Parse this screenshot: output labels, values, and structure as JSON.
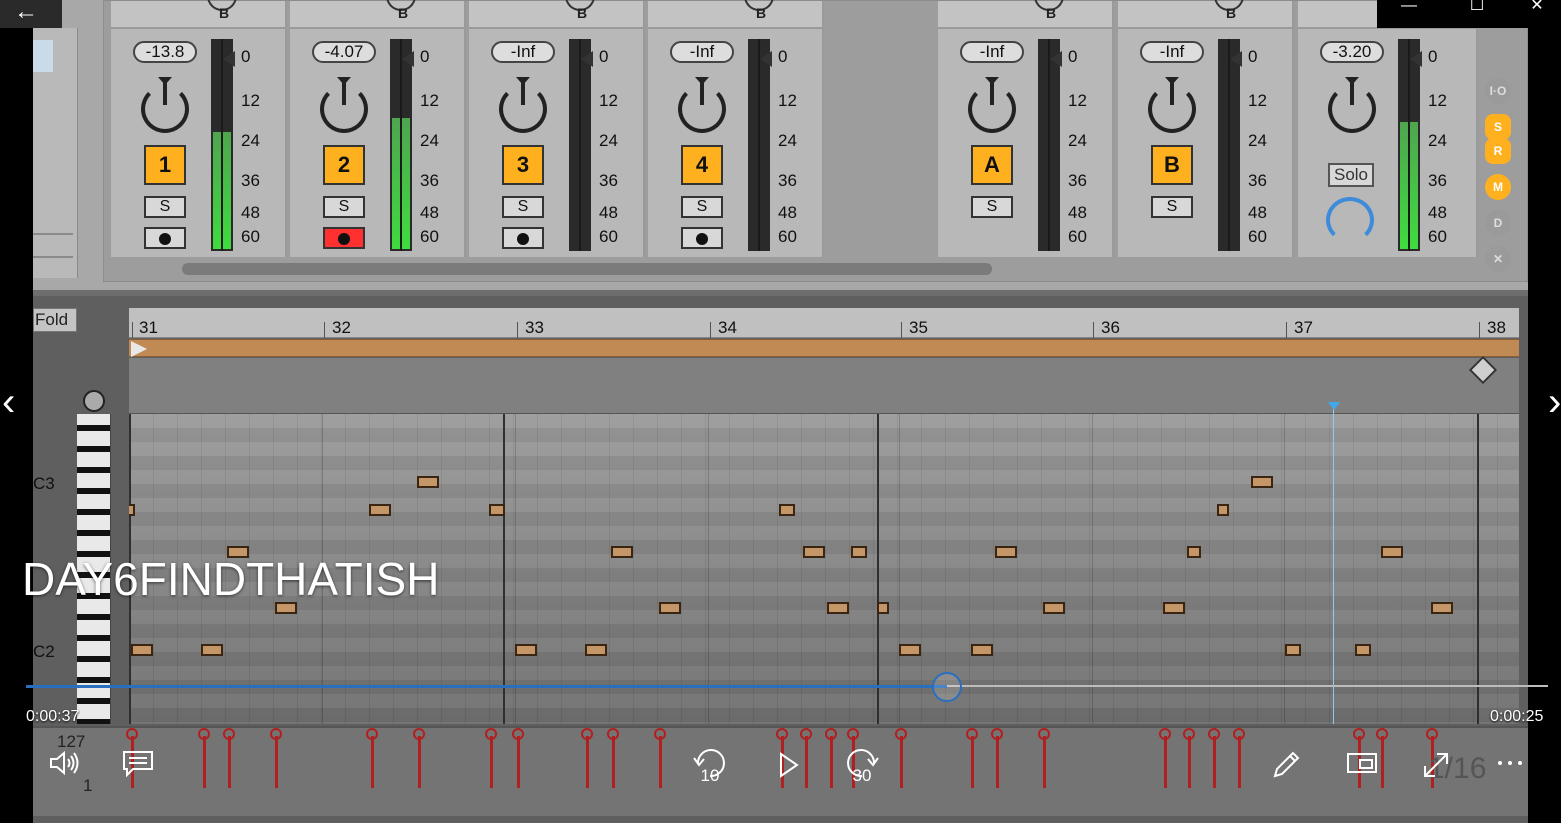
{
  "player": {
    "title": "DAY6FINDTHATISH",
    "elapsed": "0:00:37",
    "remaining": "0:00:25",
    "progress_fraction": 0.605,
    "accent_color": "#2a6fbf",
    "back_icon": "arrow-left-icon",
    "skip_back_label": "10",
    "skip_forward_label": "30",
    "window_controls": [
      "minimize-icon",
      "maximize-icon",
      "close-icon"
    ]
  },
  "mixer": {
    "strips": [
      {
        "id": "1",
        "volume": "-13.8",
        "ab": "B",
        "meter_level": 0.55,
        "solo": "S",
        "armed": false,
        "type": "audio"
      },
      {
        "id": "2",
        "volume": "-4.07",
        "ab": "B",
        "meter_level": 0.62,
        "solo": "S",
        "armed": true,
        "type": "audio"
      },
      {
        "id": "3",
        "volume": "-Inf",
        "ab": "B",
        "meter_level": 0,
        "solo": "S",
        "armed": false,
        "type": "midi"
      },
      {
        "id": "4",
        "volume": "-Inf",
        "ab": "B",
        "meter_level": 0,
        "solo": "S",
        "armed": false,
        "type": "midi"
      },
      {
        "id": "A",
        "volume": "-Inf",
        "ab": "B",
        "meter_level": 0,
        "solo": "S",
        "type": "return"
      },
      {
        "id": "B",
        "volume": "-Inf",
        "ab": "B",
        "meter_level": 0,
        "solo": "S",
        "type": "return"
      },
      {
        "id": "master",
        "volume": "-3.20",
        "ab": "B",
        "meter_level": 0.6,
        "solo_label": "Solo",
        "type": "master"
      }
    ],
    "scale": [
      "0",
      "12",
      "24",
      "36",
      "48",
      "60"
    ],
    "side_icons": [
      {
        "label": "I·O",
        "color": "#9a9a9a"
      },
      {
        "label": "S",
        "color": "#ffb01f"
      },
      {
        "label": "R",
        "color": "#ffb01f"
      },
      {
        "label": "M",
        "color": "#ffb01f"
      },
      {
        "label": "D",
        "color": "#9a9a9a"
      },
      {
        "label": "✕",
        "color": "#9a9a9a"
      }
    ]
  },
  "clip": {
    "fold_label": "Fold",
    "bars": [
      "31",
      "32",
      "33",
      "34",
      "35",
      "36",
      "37",
      "38"
    ],
    "note_labels": [
      "C3",
      "C2"
    ],
    "velocity_axis": [
      "127",
      "1"
    ],
    "page_indicator": "1/16"
  }
}
